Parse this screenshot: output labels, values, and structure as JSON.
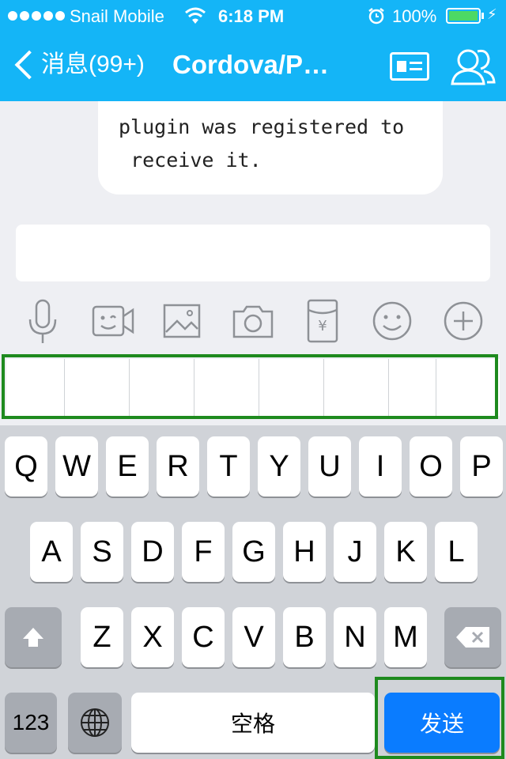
{
  "status_bar": {
    "carrier": "Snail Mobile",
    "time": "6:18 PM",
    "battery": "100%",
    "signal_dots": 5
  },
  "nav": {
    "back_label": "消息(99+)",
    "title": "Cordova/P…"
  },
  "message": {
    "text": "plugin was registered to\n receive it."
  },
  "input": {
    "value": ""
  },
  "toolbar": {
    "icons": [
      "microphone-icon",
      "video-icon",
      "image-icon",
      "camera-icon",
      "red-packet-icon",
      "emoji-icon",
      "plus-icon"
    ]
  },
  "candidates": {
    "cell_count": 8
  },
  "keyboard": {
    "row1": [
      "Q",
      "W",
      "E",
      "R",
      "T",
      "Y",
      "U",
      "I",
      "O",
      "P"
    ],
    "row2": [
      "A",
      "S",
      "D",
      "F",
      "G",
      "H",
      "J",
      "K",
      "L"
    ],
    "row3": [
      "Z",
      "X",
      "C",
      "V",
      "B",
      "N",
      "M"
    ],
    "numbers_label": "123",
    "space_label": "空格",
    "send_label": "发送",
    "accent_color": "#0a7cff"
  },
  "colors": {
    "header": "#14b5f7",
    "highlight": "#1e8a1e"
  }
}
